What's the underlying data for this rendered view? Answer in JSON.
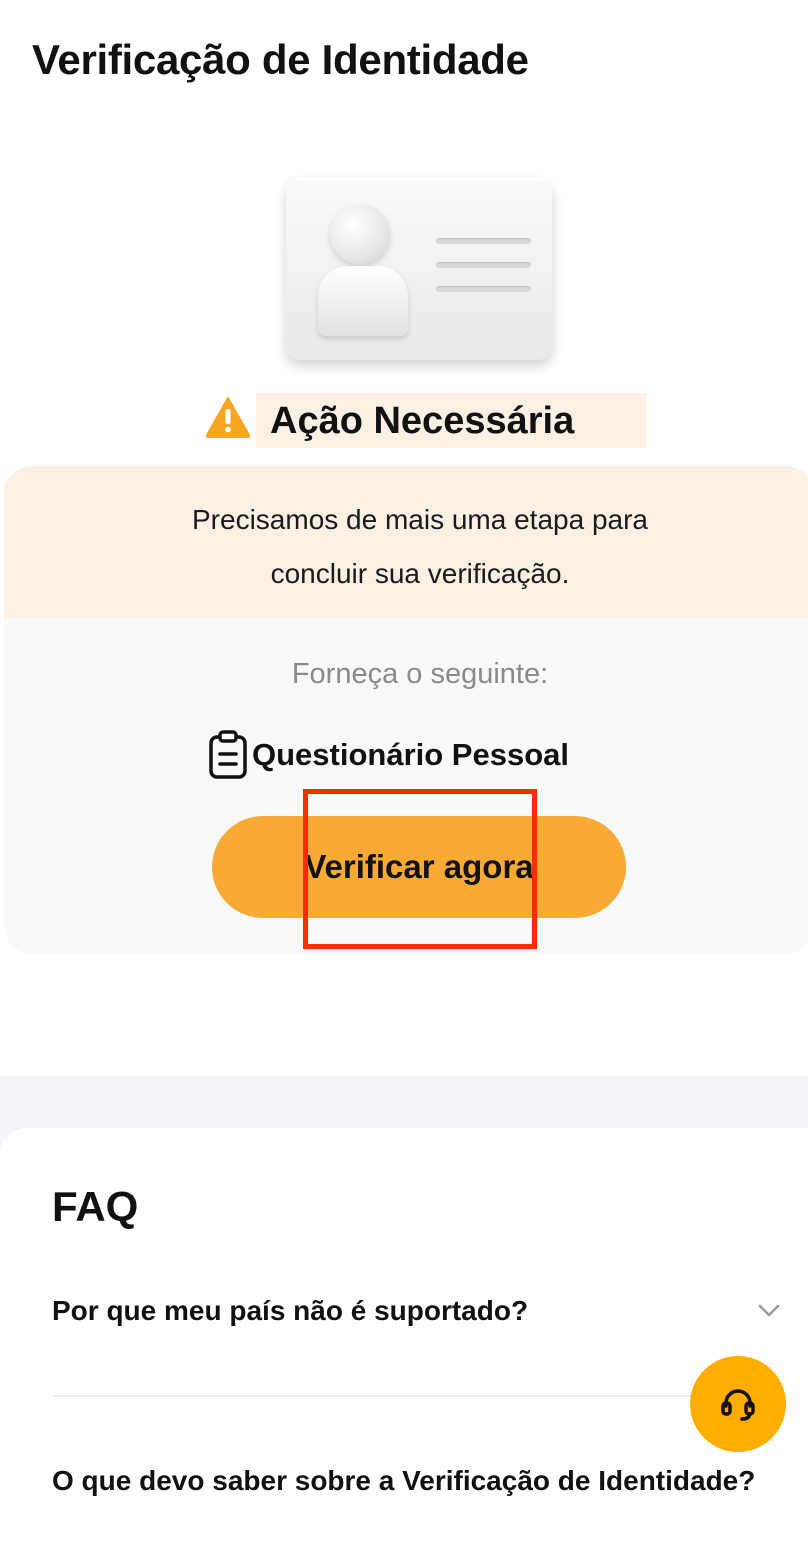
{
  "header": {
    "title": "Verificação de Identidade"
  },
  "illustration": {
    "icon": "id-card-icon"
  },
  "status": {
    "icon": "warning-icon",
    "title": "Ação Necessária",
    "message_line1": "Precisamos de mais uma etapa para",
    "message_line2": "concluir sua verificação."
  },
  "requirements": {
    "label": "Forneça o seguinte:",
    "item": {
      "icon": "clipboard-icon",
      "label": "Questionário Pessoal"
    }
  },
  "verify_button": {
    "label": "Verificar agora"
  },
  "faq": {
    "title": "FAQ",
    "questions": [
      {
        "label": "Por que meu país não é suportado?"
      },
      {
        "label": "O que devo saber sobre a Verificação de Identidade?"
      }
    ]
  },
  "support": {
    "icon": "headset-icon"
  },
  "colors": {
    "accent": "#f9aa34",
    "support_button": "#ffad00",
    "highlight": "#ff2a06",
    "warning_bg": "#fbf0e4",
    "card_bg": "#f8f9fb"
  }
}
